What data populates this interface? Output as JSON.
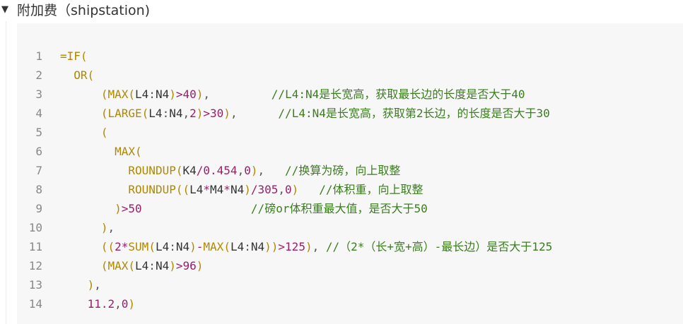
{
  "heading": {
    "toggle_glyph": "▼",
    "title": "附加费（shipstation)"
  },
  "code_block": {
    "language": "excel-formula",
    "colors": {
      "background": "#f7f7f7",
      "function": "#b08800",
      "number": "#9a1e69",
      "comment": "#3b7d1f",
      "plain": "#333333",
      "line_number": "#888888"
    },
    "lines": [
      {
        "n": "1",
        "text": "=IF("
      },
      {
        "n": "2",
        "text": "  OR("
      },
      {
        "n": "3",
        "text": "      (MAX(L4:N4)>40),         //L4:N4是长宽高，获取最长边的长度是否大于40"
      },
      {
        "n": "4",
        "text": "      (LARGE(L4:N4,2)>30),      //L4:N4是长宽高，获取第2长边，的长度是否大于30"
      },
      {
        "n": "5",
        "text": "      ("
      },
      {
        "n": "6",
        "text": "        MAX("
      },
      {
        "n": "7",
        "text": "          ROUNDUP(K4/0.454,0),   //换算为磅，向上取整"
      },
      {
        "n": "8",
        "text": "          ROUNDUP((L4*M4*N4)/305,0)   //体积重，向上取整"
      },
      {
        "n": "9",
        "text": "        )>50                //磅or体积重最大值，是否大于50"
      },
      {
        "n": "10",
        "text": "      ),"
      },
      {
        "n": "11",
        "text": "      ((2*SUM(L4:N4)-MAX(L4:N4))>125), //（2*（长+宽+高）-最长边）是否大于125"
      },
      {
        "n": "12",
        "text": "      (MAX(L4:N4)>96)"
      },
      {
        "n": "13",
        "text": "    ),"
      },
      {
        "n": "14",
        "text": "    11.2,0)"
      }
    ]
  }
}
